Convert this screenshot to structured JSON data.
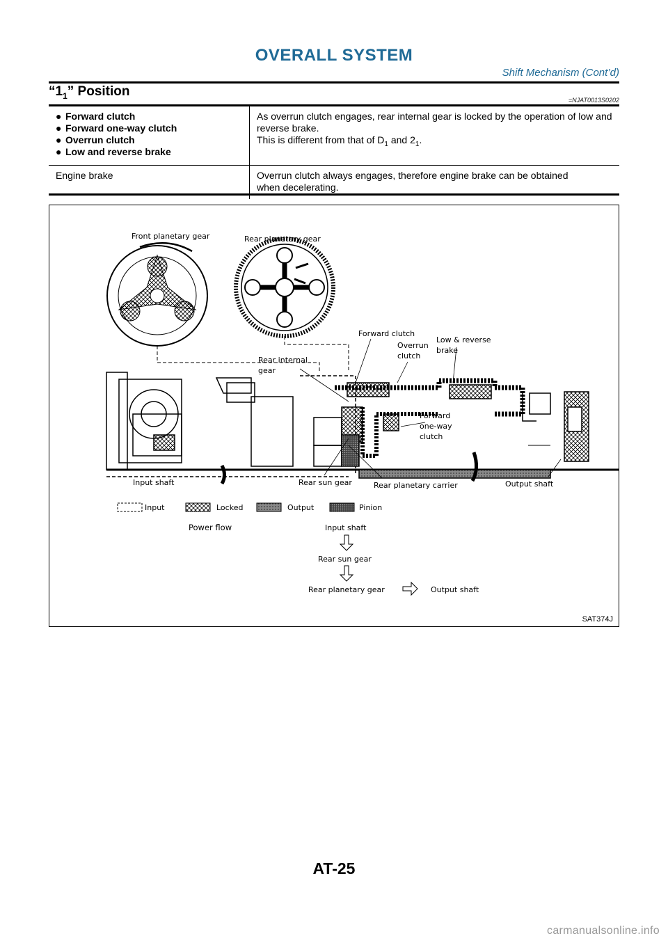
{
  "header": {
    "title": "OVERALL SYSTEM",
    "subtitle": "Shift Mechanism (Cont’d)"
  },
  "section": {
    "heading_pre": "“1",
    "heading_sub": "1",
    "heading_post": "” Position",
    "code": "=NJAT0013S0202"
  },
  "table": {
    "row1": {
      "items": [
        "Forward clutch",
        "Forward one-way clutch",
        "Overrun clutch",
        "Low and reverse brake"
      ],
      "text_line1": "As overrun clutch engages, rear internal gear is locked by the operation of low and",
      "text_line2": "reverse brake.",
      "text_line3_a": "This is different from that of D",
      "text_line3_b": "1",
      "text_line3_c": " and 2",
      "text_line3_d": "1",
      "text_line3_e": "."
    },
    "row2": {
      "label": "Engine brake",
      "text": "Overrun clutch always engages, therefore engine brake can be obtained when decelerating."
    }
  },
  "figure": {
    "labels": {
      "front_planetary": "Front planetary gear",
      "rear_planetary": "Rear planetary gear",
      "forward_clutch": "Forward clutch",
      "overrun": "Overrun",
      "overrun_clutch": "clutch",
      "low_reverse": "Low & reverse",
      "brake": "brake",
      "rear_internal": "Rear internal",
      "gear": "gear",
      "forward": "Forward",
      "one_way": "one-way",
      "clutch": "clutch",
      "input_shaft": "Input shaft",
      "rear_sun_gear": "Rear sun gear",
      "rear_planetary_carrier": "Rear planetary carrier",
      "output_shaft": "Output shaft"
    },
    "legend": {
      "input": "Input",
      "locked": "Locked",
      "output": "Output",
      "pinion": "Pinion"
    },
    "power_flow": {
      "title": "Power flow",
      "step1": "Input shaft",
      "step2": "Rear sun gear",
      "step3": "Rear planetary gear",
      "step4": "Output shaft"
    },
    "code": "SAT374J"
  },
  "page_number": "AT-25",
  "watermark": "carmanualsonline.info"
}
